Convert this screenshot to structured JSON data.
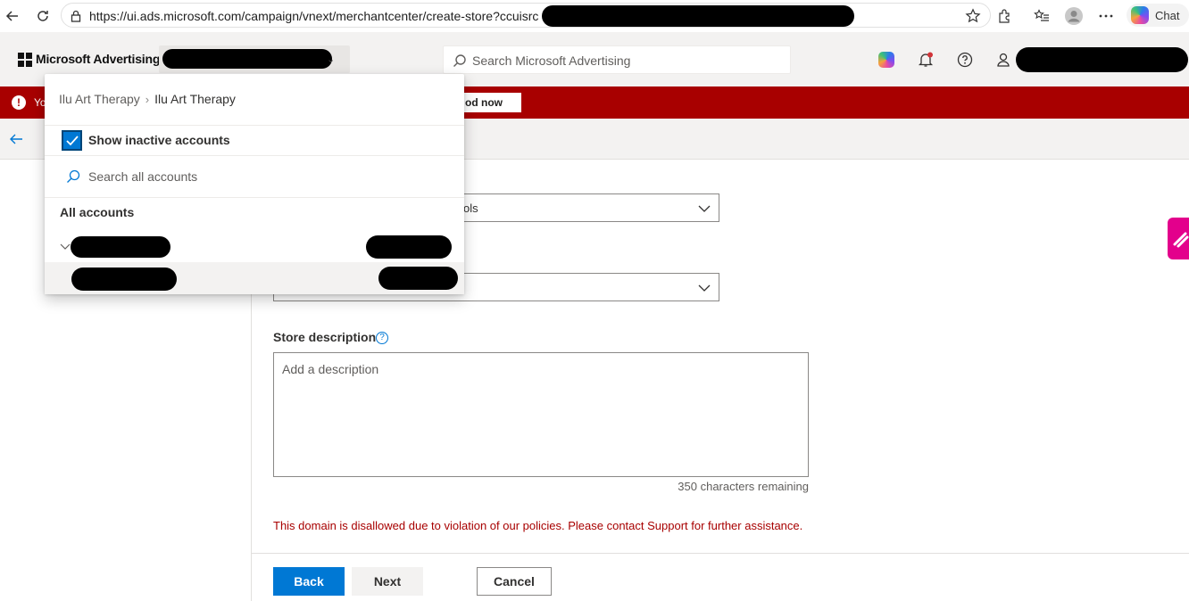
{
  "browser": {
    "url": "https://ui.ads.microsoft.com/campaign/vnext/merchantcenter/create-store?ccuisrc",
    "chat_label": "Chat"
  },
  "header": {
    "brand": "Microsoft Advertising",
    "search_placeholder": "Search Microsoft Advertising"
  },
  "banner": {
    "text": "Yo",
    "button_label": "od now"
  },
  "form": {
    "select1_value": "ols",
    "description_label": "Store description",
    "description_help": "?",
    "description_placeholder": "Add a description",
    "chars_remaining": "350 characters remaining",
    "error_message": "This domain is disallowed due to violation of our policies. Please contact Support for further assistance."
  },
  "buttons": {
    "back": "Back",
    "next": "Next",
    "cancel": "Cancel"
  },
  "account_dropdown": {
    "breadcrumb_parent": "Ilu Art Therapy",
    "breadcrumb_current": "Ilu Art Therapy",
    "show_inactive_label": "Show inactive accounts",
    "show_inactive_checked": true,
    "search_placeholder": "Search all accounts",
    "section_title": "All accounts"
  },
  "colors": {
    "accent": "#0078d4",
    "banner": "#a80000",
    "error": "#a80000",
    "side_tab": "#e3008c"
  }
}
